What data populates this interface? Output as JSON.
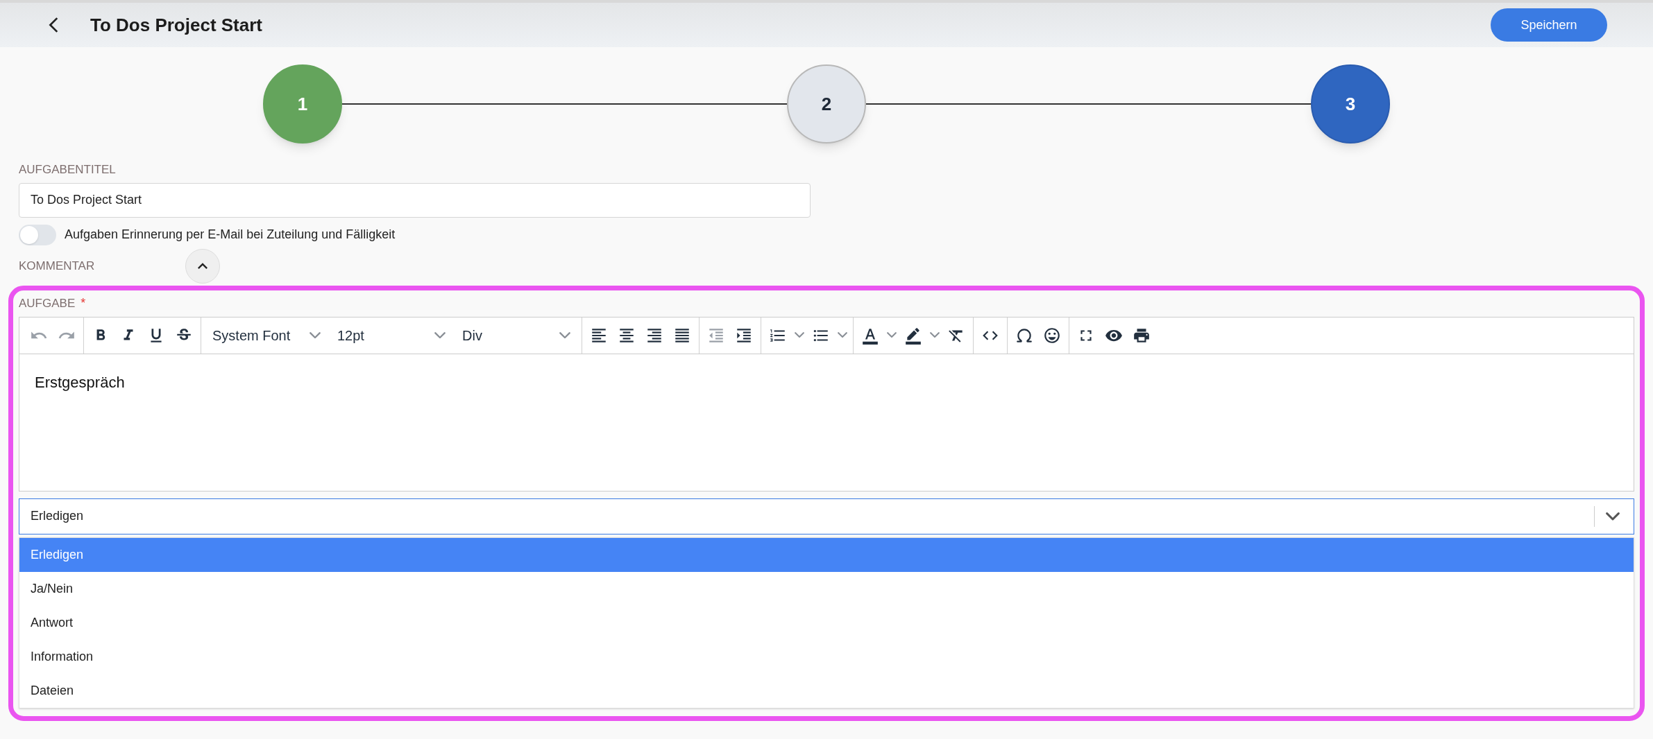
{
  "header": {
    "title": "To Dos Project Start",
    "save_button": "Speichern"
  },
  "steps": [
    {
      "label": "1",
      "completed": true,
      "selected": false
    },
    {
      "label": "2",
      "completed": false,
      "selected": false
    },
    {
      "label": "3",
      "completed": false,
      "selected": true
    }
  ],
  "title_field": {
    "label": "AUFGABENTITEL",
    "value": "To Dos Project Start"
  },
  "reminder_toggle": {
    "label": "Aufgaben Erinnerung per E-Mail bei Zuteilung und Fälligkeit",
    "on": false
  },
  "comment": {
    "label": "KOMMENTAR"
  },
  "task": {
    "label": "AUFGABE",
    "required_mark": "*",
    "toolbar": {
      "undo": {
        "disabled": true
      },
      "redo": {
        "disabled": true
      },
      "font": "System Font",
      "size": "12pt",
      "block": "Div",
      "outdent": {
        "disabled": true
      },
      "indent": {
        "disabled": false
      }
    },
    "content": "Erstgespräch",
    "type_select": {
      "value": "Erledigen",
      "expanded": true,
      "options": [
        {
          "label": "Erledigen",
          "selected": true
        },
        {
          "label": "Ja/Nein",
          "selected": false
        },
        {
          "label": "Antwort",
          "selected": false
        },
        {
          "label": "Information",
          "selected": false
        },
        {
          "label": "Dateien",
          "selected": false
        }
      ]
    }
  }
}
